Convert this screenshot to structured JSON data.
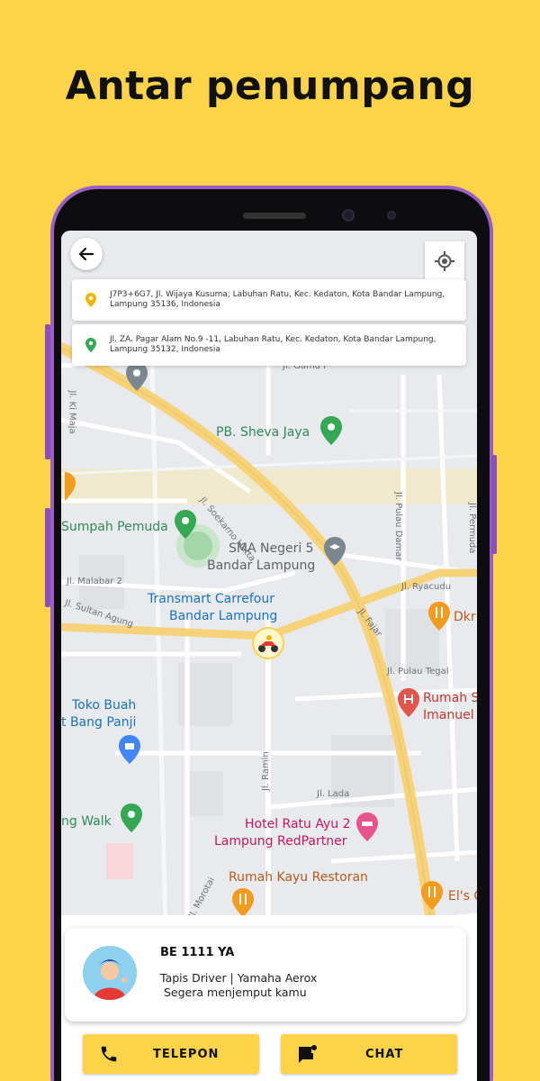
{
  "headline": "Antar penumpang",
  "addresses": {
    "pickup": "J7P3+6G7, Jl. Wijaya Kusuma, Labuhan Ratu, Kec. Kedaton, Kota Bandar Lampung, Lampung 35136, Indonesia",
    "destination": "Jl. ZA. Pagar Alam No.9 -11, Labuhan Ratu, Kec. Kedaton, Kota Bandar Lampung, Lampung 35132, Indonesia"
  },
  "map": {
    "pois": {
      "sheva": "PB. Sheva Jaya",
      "sumpah": "Sumpah Pemuda",
      "sma1": "SMA Negeri 5",
      "sma2": "Bandar Lampung",
      "transmart1": "Transmart Carrefour",
      "transmart2": "Bandar Lampung",
      "tokobuah1": "Toko Buah",
      "tokobuah2": "t Bang Panji",
      "walk": "ng Walk",
      "hotel1": "Hotel Ratu Ayu 2",
      "hotel2": "Lampung RedPartner",
      "kayu": "Rumah Kayu Restoran",
      "rumahs1": "Rumah S",
      "rumahs2": "Imanuel",
      "dkr": "Dkr",
      "els": "El's C"
    },
    "streets": {
      "gama": "Jl. Gama I",
      "kimaja": "Jl. Ki Maja",
      "soekarno": "Jl. Soekarno Hatta",
      "pulaudamar": "Jl. Pulau Damar",
      "pemuda": "Jl. Permuda",
      "malabar": "Jl. Malabar 2",
      "sultan": "Jl. Sultan Agung",
      "ryacudu": "Jl. Ryacudu",
      "fajar": "Jl. Fajar",
      "pulautegal": "Jl. Pulau Tegal",
      "ramin": "Jl. Ramin",
      "lada": "Jl. Lada",
      "morotai": "Jl. Morotai"
    }
  },
  "driver": {
    "plate": "BE 1111 YA",
    "info": "Tapis Driver | Yamaha Aerox",
    "status": "Segera menjemput kamu"
  },
  "actions": {
    "call_label": "TELEPON",
    "chat_label": "CHAT"
  },
  "colors": {
    "background": "#FDD34A",
    "accent": "#FDD34A",
    "phone_frame": "#9a5fc7",
    "main_road": "#f6d37a"
  },
  "icons": [
    "back-arrow-icon",
    "my-location-icon",
    "pickup-pin-icon",
    "destination-pin-icon",
    "phone-icon",
    "chat-icon"
  ]
}
